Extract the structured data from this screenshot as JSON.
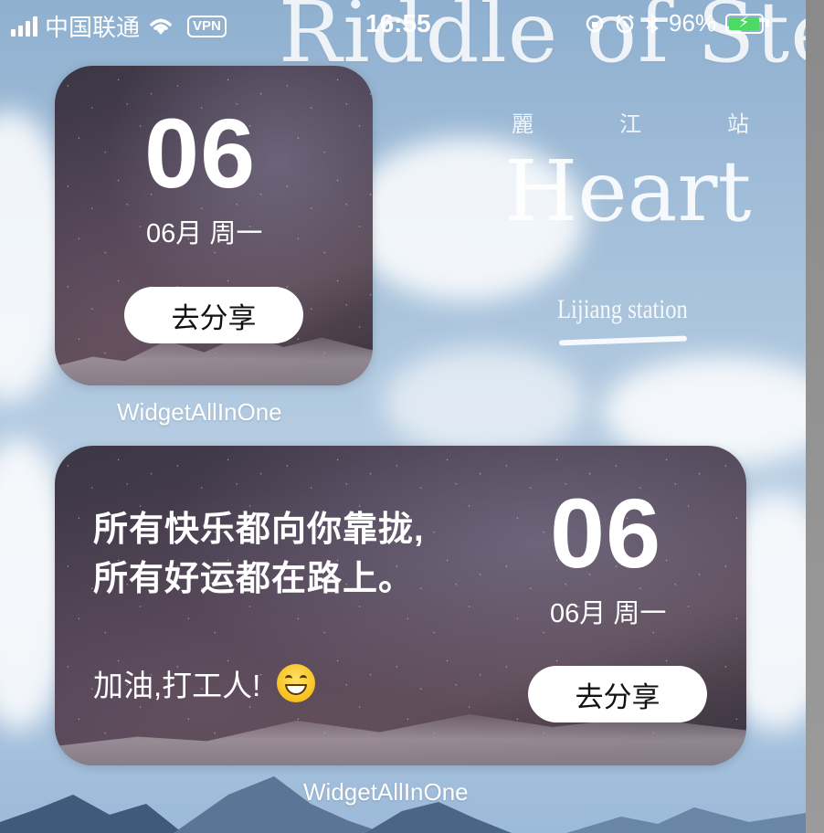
{
  "status_bar": {
    "carrier": "中国联通",
    "vpn": "VPN",
    "time": "16:55",
    "battery": "96%",
    "battery_level": 0.96,
    "icons": [
      "signal-icon",
      "wifi-icon",
      "vpn-badge",
      "orientation-lock-icon",
      "alarm-icon",
      "bluetooth-icon",
      "battery-icon"
    ]
  },
  "wallpaper": {
    "title": "Riddle of Stea",
    "subtitle_cn": [
      "麗",
      "江",
      "站"
    ],
    "heart": "Heart",
    "station": "Lijiang station"
  },
  "widget_small": {
    "day": "06",
    "date_line": "06月 周一",
    "share_label": "去分享",
    "caption": "WidgetAllInOne"
  },
  "widget_medium": {
    "quote_line1": "所有快乐都向你靠拢,",
    "quote_line2": "所有好运都在路上。",
    "cheer": "加油,打工人!",
    "cheer_emoji": "grinning-face",
    "day": "06",
    "date_line": "06月 周一",
    "share_label": "去分享",
    "caption": "WidgetAllInOne"
  },
  "colors": {
    "battery_fill": "#4cd964",
    "button_bg": "#ffffff",
    "button_text": "#111111"
  }
}
